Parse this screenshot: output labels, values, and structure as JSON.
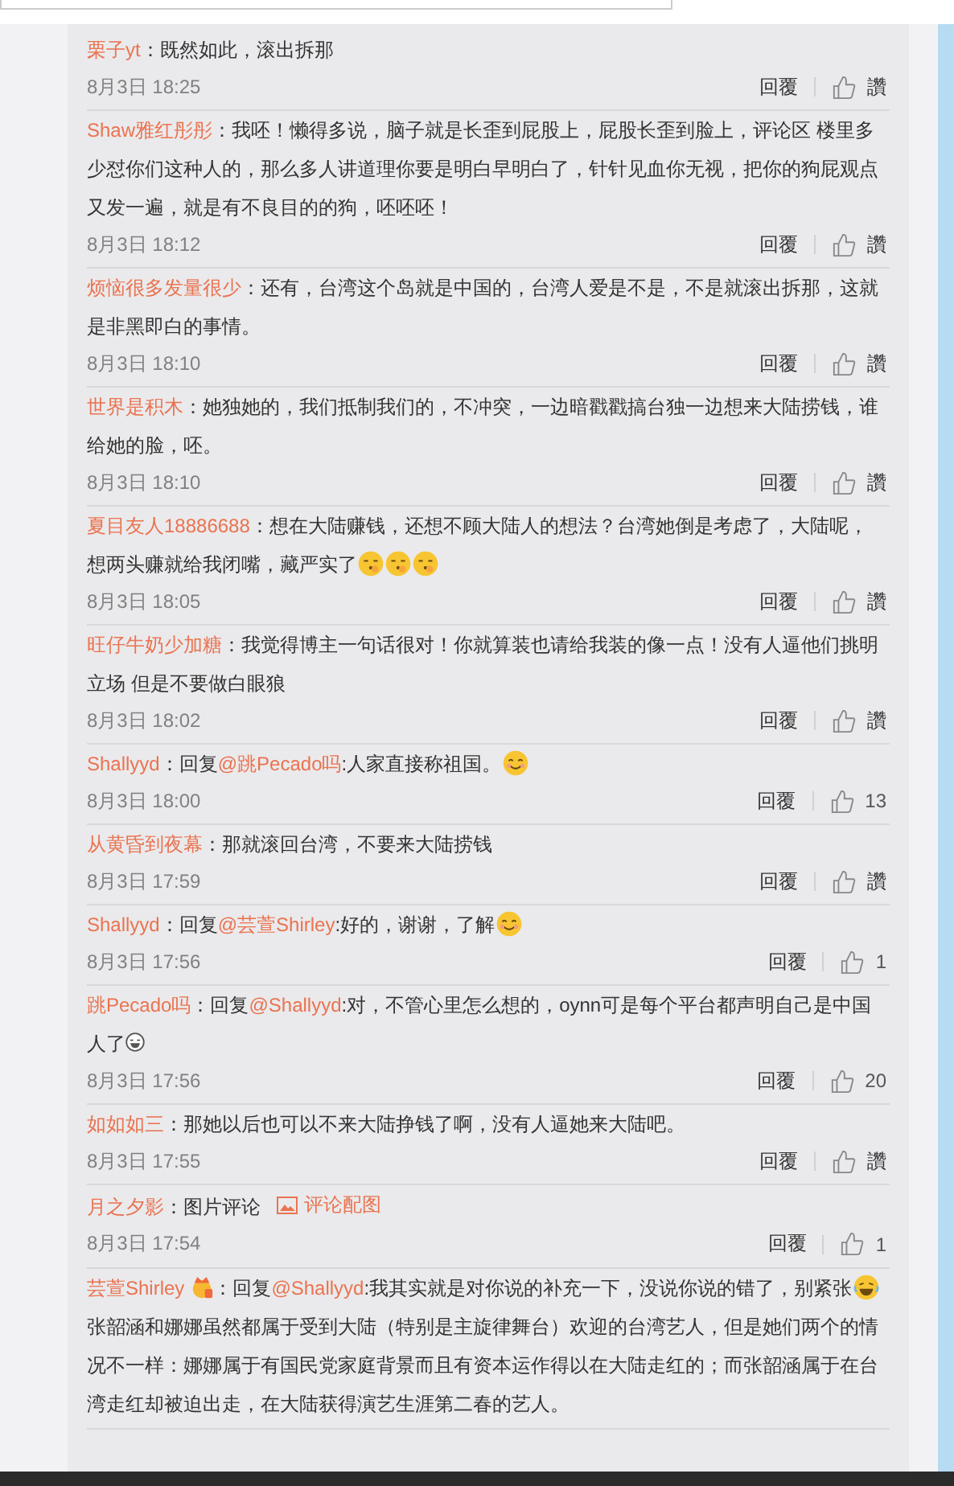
{
  "comments": [
    {
      "author": "栗子yt",
      "badge": false,
      "content": [
        {
          "kind": "text",
          "text": "：既然如此，滚出拆那"
        }
      ],
      "time": "8月3日 18:25",
      "reply": "回覆",
      "like": "讚"
    },
    {
      "author": "Shaw雅红彤彤",
      "badge": false,
      "content": [
        {
          "kind": "text",
          "text": "：我呸！懒得多说，脑子就是长歪到屁股上，屁股长歪到脸上，评论区 楼里多少怼你们这种人的，那么多人讲道理你要是明白早明白了，针针见血你无视，把你的狗屁观点又发一遍，就是有不良目的的狗，呸呸呸！"
        }
      ],
      "time": "8月3日 18:12",
      "reply": "回覆",
      "like": "讚"
    },
    {
      "author": "烦恼很多发量很少",
      "badge": false,
      "content": [
        {
          "kind": "text",
          "text": "：还有，台湾这个岛就是中国的，台湾人爱是不是，不是就滚出拆那，这就是非黑即白的事情。"
        }
      ],
      "time": "8月3日 18:10",
      "reply": "回覆",
      "like": "讚"
    },
    {
      "author": "世界是积木",
      "badge": false,
      "content": [
        {
          "kind": "text",
          "text": "：她独她的，我们抵制我们的，不冲突，一边暗戳戳搞台独一边想来大陆捞钱，谁给她的脸，呸。"
        }
      ],
      "time": "8月3日 18:10",
      "reply": "回覆",
      "like": "讚"
    },
    {
      "author": "夏目友人18886688",
      "badge": false,
      "content": [
        {
          "kind": "text",
          "text": "：想在大陆赚钱，还想不顾大陆人的想法？台湾她倒是考虑了，大陆呢，想两头赚就给我闭嘴，藏严实了"
        },
        {
          "kind": "hush"
        },
        {
          "kind": "hush"
        },
        {
          "kind": "hush"
        }
      ],
      "time": "8月3日 18:05",
      "reply": "回覆",
      "like": "讚"
    },
    {
      "author": "旺仔牛奶少加糖",
      "badge": false,
      "content": [
        {
          "kind": "text",
          "text": "：我觉得博主一句话很对！你就算装也请给我装的像一点！没有人逼他们挑明立场 但是不要做白眼狼"
        }
      ],
      "time": "8月3日 18:02",
      "reply": "回覆",
      "like": "讚"
    },
    {
      "author": "Shallyyd",
      "badge": false,
      "content": [
        {
          "kind": "text",
          "text": "：回复"
        },
        {
          "kind": "mention",
          "text": "@跳Pecado吗"
        },
        {
          "kind": "text",
          "text": ":人家直接称祖国。"
        },
        {
          "kind": "smile"
        }
      ],
      "time": "8月3日 18:00",
      "reply": "回覆",
      "like": "13"
    },
    {
      "author": "从黄昏到夜幕",
      "badge": false,
      "content": [
        {
          "kind": "text",
          "text": "：那就滚回台湾，不要来大陆捞钱"
        }
      ],
      "time": "8月3日 17:59",
      "reply": "回覆",
      "like": "讚"
    },
    {
      "author": "Shallyyd",
      "badge": false,
      "content": [
        {
          "kind": "text",
          "text": "：回复"
        },
        {
          "kind": "mention",
          "text": "@芸萱Shirley"
        },
        {
          "kind": "text",
          "text": ":好的，谢谢，了解"
        },
        {
          "kind": "smile"
        }
      ],
      "time": "8月3日 17:56",
      "reply": "回覆",
      "like": "1"
    },
    {
      "author": "跳Pecado吗",
      "badge": false,
      "content": [
        {
          "kind": "text",
          "text": "：回复"
        },
        {
          "kind": "mention",
          "text": "@Shallyyd"
        },
        {
          "kind": "text",
          "text": ":对，不管心里怎么想的，oynn可是每个平台都声明自己是中国人了"
        },
        {
          "kind": "grin"
        }
      ],
      "time": "8月3日 17:56",
      "reply": "回覆",
      "like": "20"
    },
    {
      "author": "如如如三",
      "badge": false,
      "content": [
        {
          "kind": "text",
          "text": "：那她以后也可以不来大陆挣钱了啊，没有人逼她来大陆吧。"
        }
      ],
      "time": "8月3日 17:55",
      "reply": "回覆",
      "like": "讚"
    },
    {
      "author": "月之夕影",
      "badge": false,
      "content": [
        {
          "kind": "text",
          "text": "：图片评论"
        },
        {
          "kind": "image-link",
          "text": "评论配图"
        }
      ],
      "time": "8月3日 17:54",
      "reply": "回覆",
      "like": "1"
    },
    {
      "author": "芸萱Shirley",
      "badge": true,
      "content": [
        {
          "kind": "text",
          "text": "：回复"
        },
        {
          "kind": "mention",
          "text": "@Shallyyd"
        },
        {
          "kind": "text",
          "text": ":我其实就是对你说的补充一下，没说你说的错了，别紧张"
        },
        {
          "kind": "laugh"
        },
        {
          "kind": "text",
          "text": "张韶涵和娜娜虽然都属于受到大陆（特别是主旋律舞台）欢迎的台湾艺人，但是她们两个的情况不一样：娜娜属于有国民党家庭背景而且有资本运作得以在大陆走红的；而张韶涵属于在台湾走红却被迫出走，在大陆获得演艺生涯第二春的艺人。"
        }
      ]
    }
  ]
}
